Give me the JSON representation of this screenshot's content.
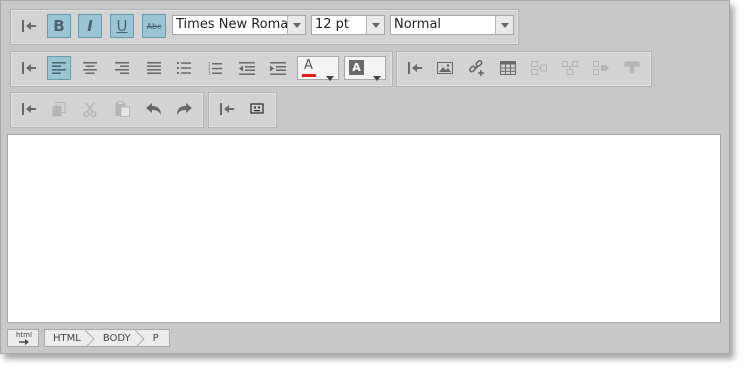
{
  "toolbar": {
    "font_family": {
      "value": "Times New Roman"
    },
    "font_size": {
      "value": "12 pt"
    },
    "paragraph_style": {
      "value": "Normal"
    },
    "bold_label": "B",
    "italic_label": "I",
    "underline_label": "U",
    "strike_label": "Abc",
    "font_color_label": "A",
    "highlight_label": "A"
  },
  "colors": {
    "active_button": "#9ac5d3",
    "font_color_bar": "#e31b1b",
    "icon": "#6a6a6a",
    "icon_disabled": "#b5b5b5"
  },
  "status_bar": {
    "mode_label": "html",
    "breadcrumbs": [
      "HTML",
      "BODY",
      "P"
    ]
  }
}
